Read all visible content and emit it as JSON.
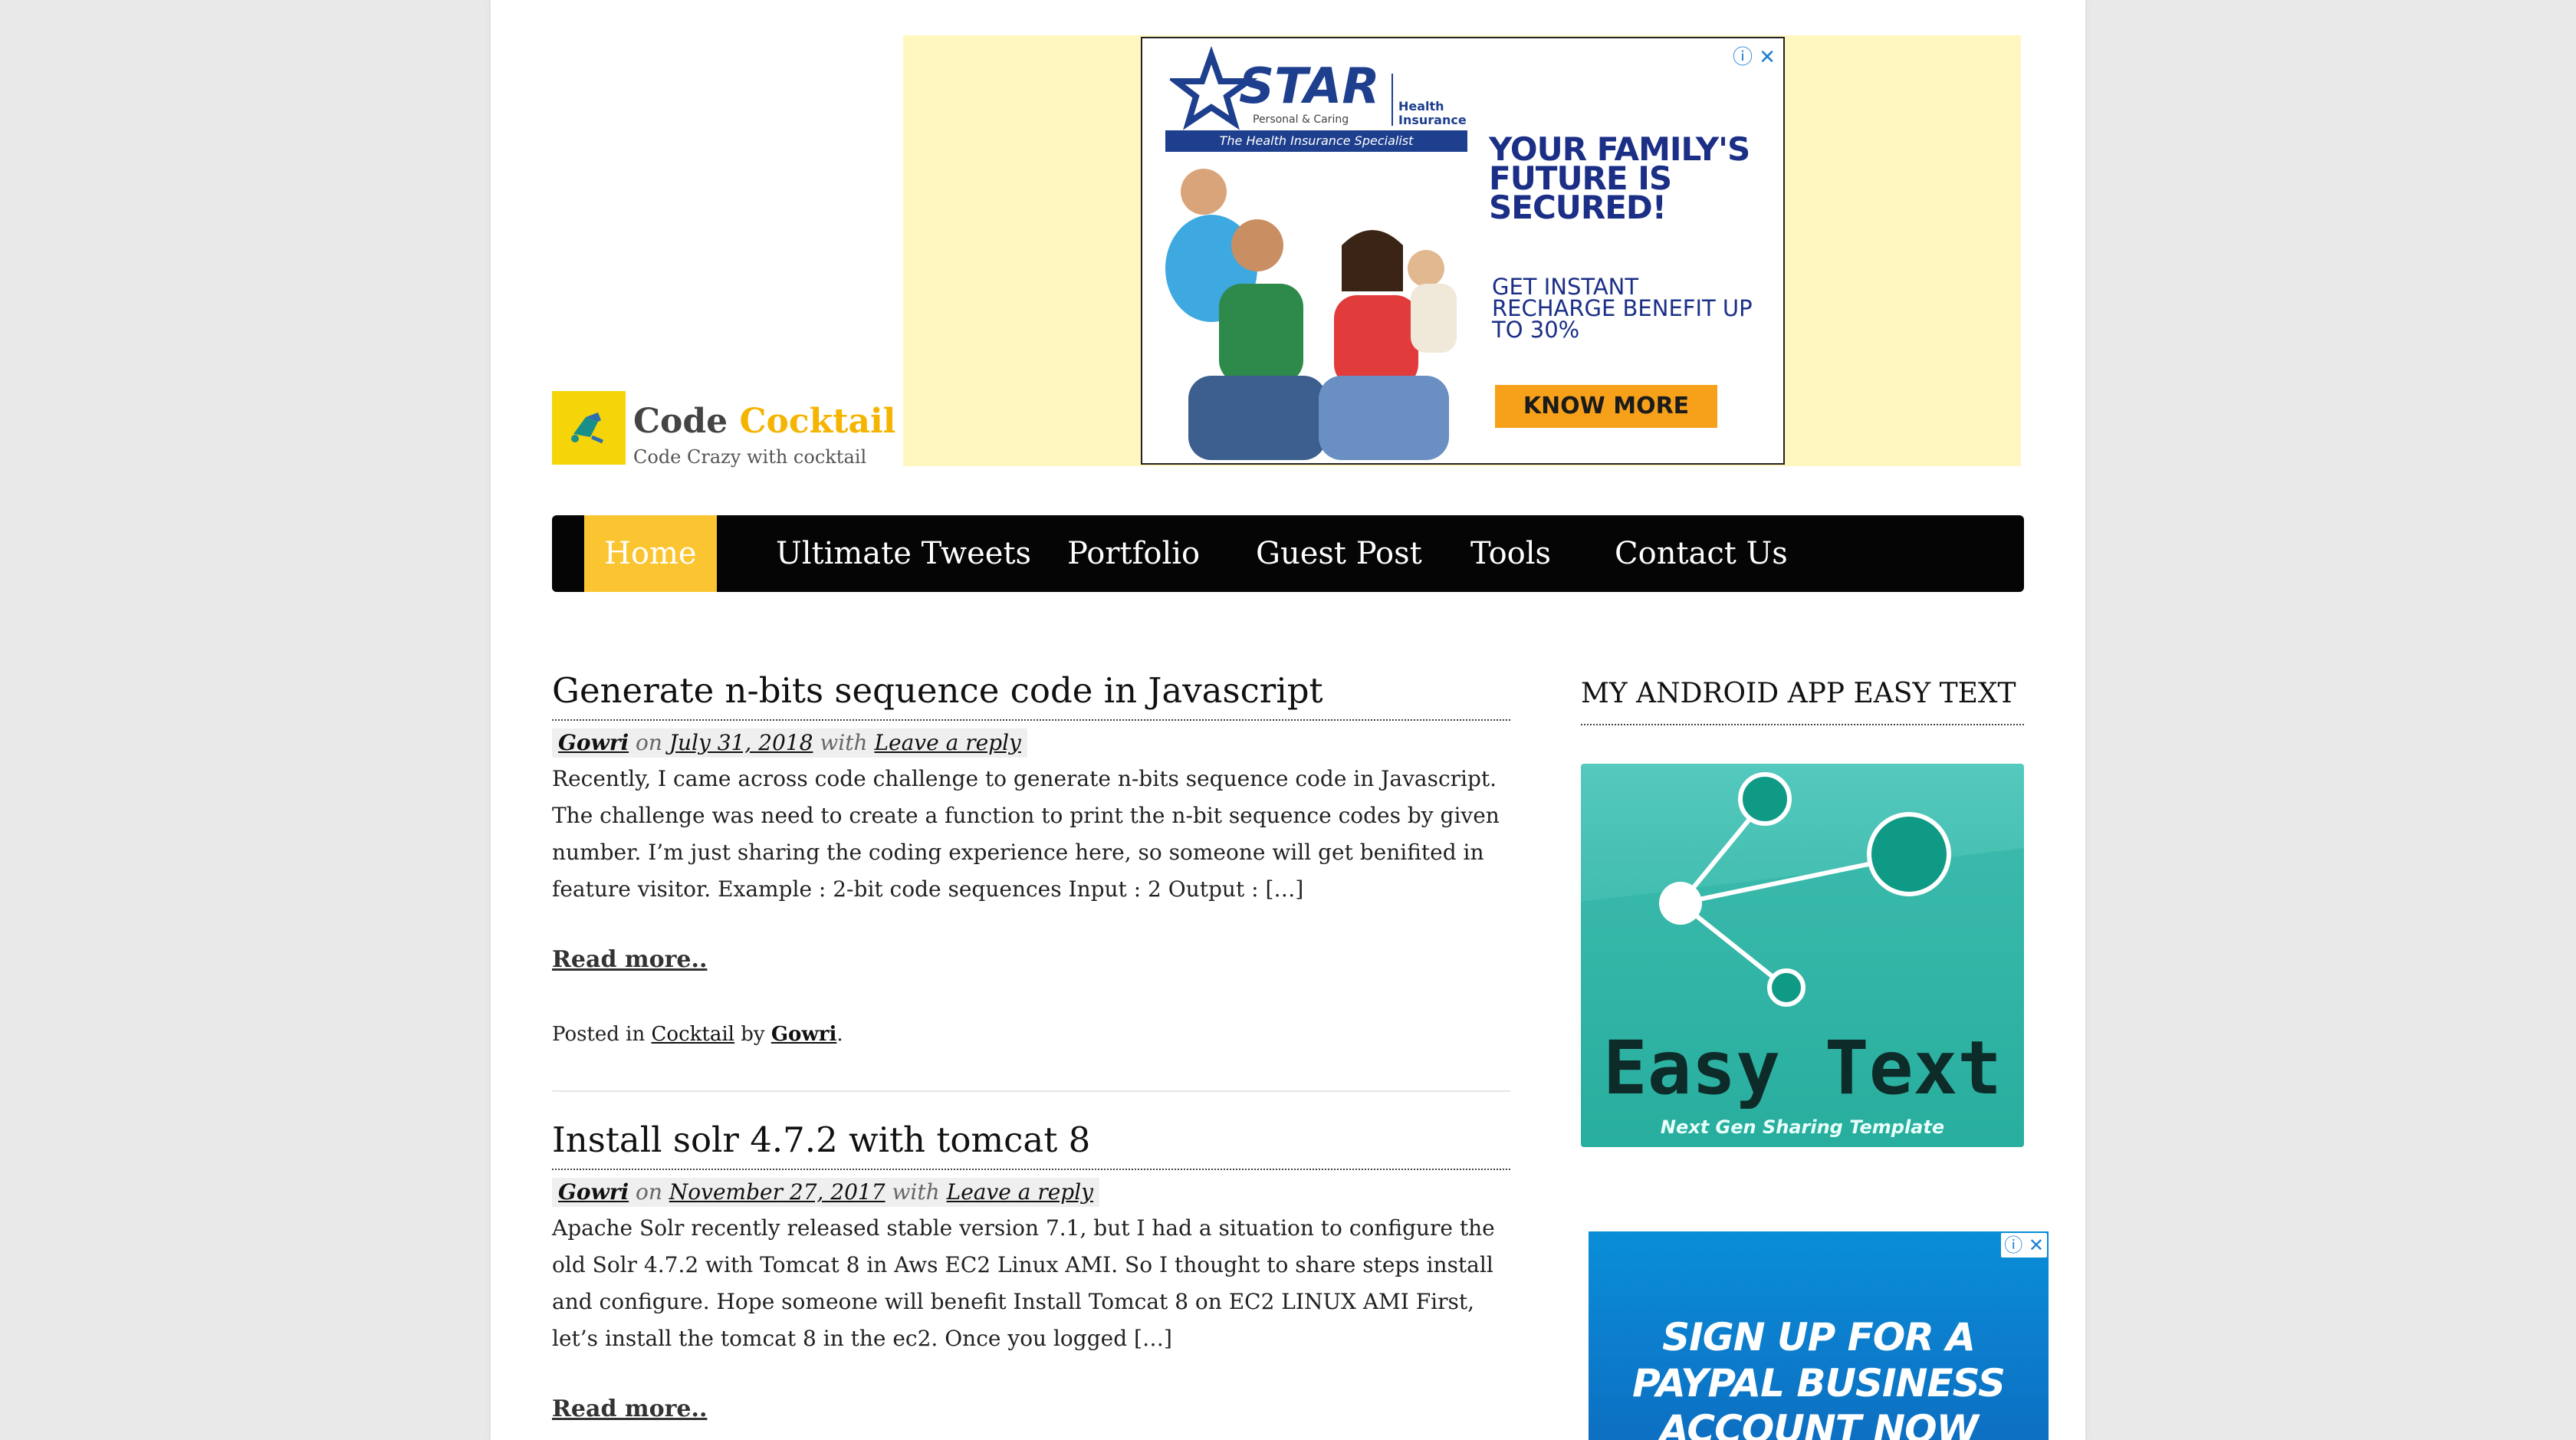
{
  "site": {
    "title_main": "Code",
    "title_accent": "Cocktail",
    "tagline": "Code Crazy with cocktail"
  },
  "top_ad": {
    "brand": "STAR",
    "brand_sub": "Personal & Caring",
    "brand_right": "Health Insurance",
    "tagline": "The Health Insurance Specialist",
    "headline": "YOUR FAMILY'S FUTURE IS SECURED!",
    "sub": "GET INSTANT RECHARGE BENEFIT UP TO 30%",
    "cta": "KNOW MORE",
    "choices_icon": "adchoices-icon"
  },
  "nav": {
    "items": [
      {
        "label": "Home",
        "active": true
      },
      {
        "label": "Ultimate Tweets"
      },
      {
        "label": "Portfolio"
      },
      {
        "label": "Guest Post"
      },
      {
        "label": "Tools"
      },
      {
        "label": "Contact Us"
      }
    ]
  },
  "posts": [
    {
      "title": "Generate n-bits sequence code in Javascript",
      "author": "Gowri",
      "on": "on",
      "date": "July 31, 2018",
      "with": "with",
      "reply": "Leave a reply",
      "excerpt": "Recently, I came across code challenge to generate n-bits sequence code in Javascript. The challenge was need to create a function to print the n-bit sequence codes by given number. I’m just sharing the coding experience here, so someone will get benifited in feature visitor. Example : 2-bit code sequences Input : 2 Output : […]",
      "read_more": "Read more..",
      "posted_in": "Posted in",
      "category": "Cocktail",
      "by": "by",
      "posted_author": "Gowri",
      "end": "."
    },
    {
      "title": "Install solr 4.7.2 with tomcat 8",
      "author": "Gowri",
      "on": "on",
      "date": "November 27, 2017",
      "with": "with",
      "reply": "Leave a reply",
      "excerpt": "Apache Solr recently released stable version 7.1, but I had a situation to configure the old Solr 4.7.2 with Tomcat 8 in Aws EC2 Linux AMI. So I thought to share steps install and configure. Hope someone will benefit Install Tomcat 8 on EC2 LINUX AMI First, let’s install the tomcat 8 in the ec2. Once you logged […]",
      "read_more": "Read more.."
    }
  ],
  "sidebar": {
    "widget_title": "MY ANDROID APP EASY TEXT",
    "app_name": "Easy Text",
    "app_tagline": "Next Gen Sharing Template",
    "paypal_text": "SIGN UP FOR A PAYPAL BUSINESS ACCOUNT NOW"
  },
  "colors": {
    "accent": "#fbc531",
    "nav_bg": "#050505",
    "ad_bg": "#fff6c0",
    "app_teal": "#2fb5a6",
    "paypal_blue": "#0a8ed8"
  }
}
